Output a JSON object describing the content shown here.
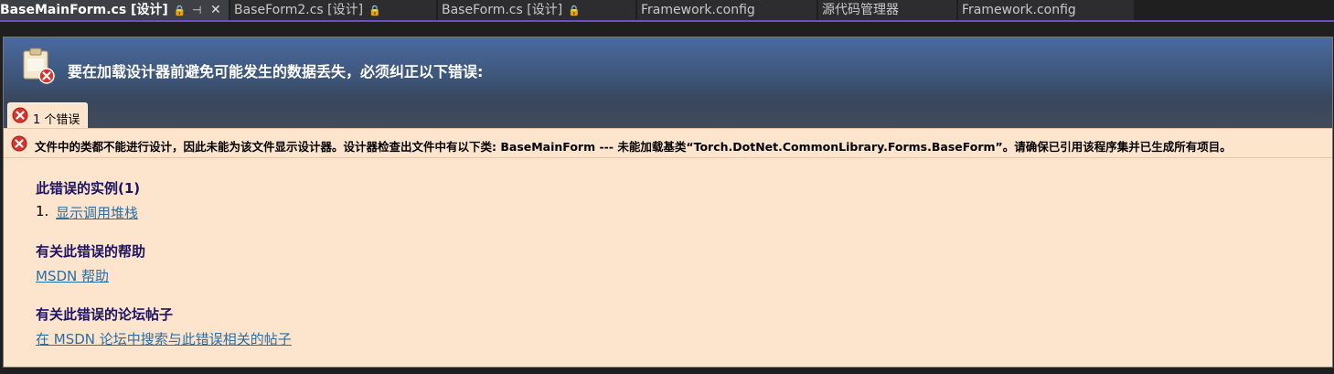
{
  "tabs": [
    {
      "label": "BaseMainForm.cs [设计]",
      "lock": "🔒",
      "pin": "⊣",
      "close": "✕",
      "active": true
    },
    {
      "label": "BaseForm2.cs [设计]",
      "lock": "🔒"
    },
    {
      "label": "BaseForm.cs [设计]",
      "lock": "🔒"
    },
    {
      "label": "Framework.config"
    },
    {
      "label": "源代码管理器"
    },
    {
      "label": "Framework.config"
    }
  ],
  "banner": {
    "title": "要在加载设计器前避免可能发生的数据丢失，必须纠正以下错误:"
  },
  "error_tab": {
    "label": "1 个错误"
  },
  "message": {
    "text": "文件中的类都不能进行设计，因此未能为该文件显示设计器。设计器检查出文件中有以下类: BaseMainForm --- 未能加载基类“Torch.DotNet.CommonLibrary.Forms.BaseForm”。请确保已引用该程序集并已生成所有项目。"
  },
  "sections": {
    "instances_title": "此错误的实例(1)",
    "instance_number": "1.",
    "instance_link": "显示调用堆栈",
    "help_title": "有关此错误的帮助",
    "help_link": "MSDN 帮助",
    "forum_title": "有关此错误的论坛帖子",
    "forum_link": "在 MSDN 论坛中搜索与此错误相关的帖子"
  },
  "colors": {
    "accent": "#6d4fc2",
    "panel_bg": "#fde4cc",
    "link": "#2a6ea6",
    "section_title": "#1b1464",
    "error_red": "#d9342b"
  },
  "icons": {
    "banner": "clipboard-error-icon",
    "error": "error-circle-icon",
    "lock": "lock-icon",
    "pin": "pin-icon",
    "close": "close-icon"
  }
}
